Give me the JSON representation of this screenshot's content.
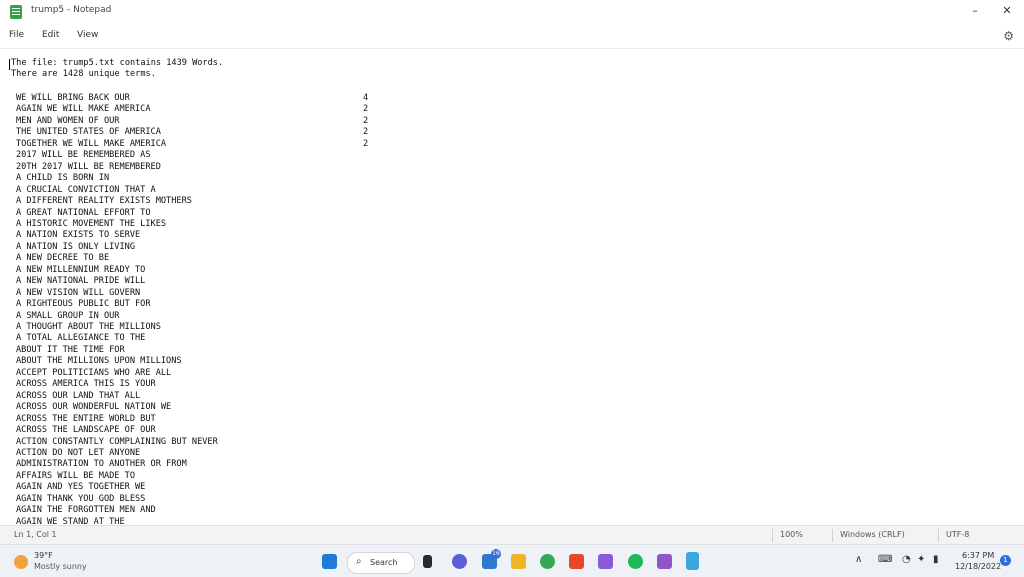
{
  "window": {
    "title": "trump5 - Notepad"
  },
  "menu": {
    "file": "File",
    "edit": "Edit",
    "view": "View"
  },
  "editor": {
    "header1": "The file: trump5.txt contains 1439 Words.",
    "header2": "There are 1428 unique terms.",
    "rows": [
      {
        "text": "WE WILL BRING BACK OUR",
        "count": "4"
      },
      {
        "text": "AGAIN WE WILL MAKE AMERICA",
        "count": "2"
      },
      {
        "text": "MEN AND WOMEN OF OUR",
        "count": "2"
      },
      {
        "text": "THE UNITED STATES OF AMERICA",
        "count": "2"
      },
      {
        "text": "TOGETHER WE WILL MAKE AMERICA",
        "count": "2"
      },
      {
        "text": "2017 WILL BE REMEMBERED AS",
        "count": ""
      },
      {
        "text": "20TH 2017 WILL BE REMEMBERED",
        "count": ""
      },
      {
        "text": "A CHILD IS BORN IN",
        "count": ""
      },
      {
        "text": "A CRUCIAL CONVICTION THAT A",
        "count": ""
      },
      {
        "text": "A DIFFERENT REALITY EXISTS MOTHERS",
        "count": ""
      },
      {
        "text": "A GREAT NATIONAL EFFORT TO",
        "count": ""
      },
      {
        "text": "A HISTORIC MOVEMENT THE LIKES",
        "count": ""
      },
      {
        "text": "A NATION EXISTS TO SERVE",
        "count": ""
      },
      {
        "text": "A NATION IS ONLY LIVING",
        "count": ""
      },
      {
        "text": "A NEW DECREE TO BE",
        "count": ""
      },
      {
        "text": "A NEW MILLENNIUM READY TO",
        "count": ""
      },
      {
        "text": "A NEW NATIONAL PRIDE WILL",
        "count": ""
      },
      {
        "text": "A NEW VISION WILL GOVERN",
        "count": ""
      },
      {
        "text": "A RIGHTEOUS PUBLIC BUT FOR",
        "count": ""
      },
      {
        "text": "A SMALL GROUP IN OUR",
        "count": ""
      },
      {
        "text": "A THOUGHT ABOUT THE MILLIONS",
        "count": ""
      },
      {
        "text": "A TOTAL ALLEGIANCE TO THE",
        "count": ""
      },
      {
        "text": "ABOUT IT THE TIME FOR",
        "count": ""
      },
      {
        "text": "ABOUT THE MILLIONS UPON MILLIONS",
        "count": ""
      },
      {
        "text": "ACCEPT POLITICIANS WHO ARE ALL",
        "count": ""
      },
      {
        "text": "ACROSS AMERICA THIS IS YOUR",
        "count": ""
      },
      {
        "text": "ACROSS OUR LAND THAT ALL",
        "count": ""
      },
      {
        "text": "ACROSS OUR WONDERFUL NATION WE",
        "count": ""
      },
      {
        "text": "ACROSS THE ENTIRE WORLD BUT",
        "count": ""
      },
      {
        "text": "ACROSS THE LANDSCAPE OF OUR",
        "count": ""
      },
      {
        "text": "ACTION CONSTANTLY COMPLAINING BUT NEVER",
        "count": ""
      },
      {
        "text": "ACTION DO NOT LET ANYONE",
        "count": ""
      },
      {
        "text": "ADMINISTRATION TO ANOTHER OR FROM",
        "count": ""
      },
      {
        "text": "AFFAIRS WILL BE MADE TO",
        "count": ""
      },
      {
        "text": "AGAIN AND YES TOGETHER WE",
        "count": ""
      },
      {
        "text": "AGAIN THANK YOU GOD BLESS",
        "count": ""
      },
      {
        "text": "AGAIN THE FORGOTTEN MEN AND",
        "count": ""
      },
      {
        "text": "AGAIN WE STAND AT THE",
        "count": ""
      }
    ]
  },
  "status": {
    "position": "Ln 1, Col 1",
    "zoom": "100%",
    "eol": "Windows (CRLF)",
    "encoding": "UTF-8"
  },
  "taskbar": {
    "weather_temp": "39°F",
    "weather_cond": "Mostly sunny",
    "search_label": "Search",
    "badge_count": "16",
    "time": "6:37 PM",
    "date": "12/18/2022",
    "notif_count": "1"
  }
}
